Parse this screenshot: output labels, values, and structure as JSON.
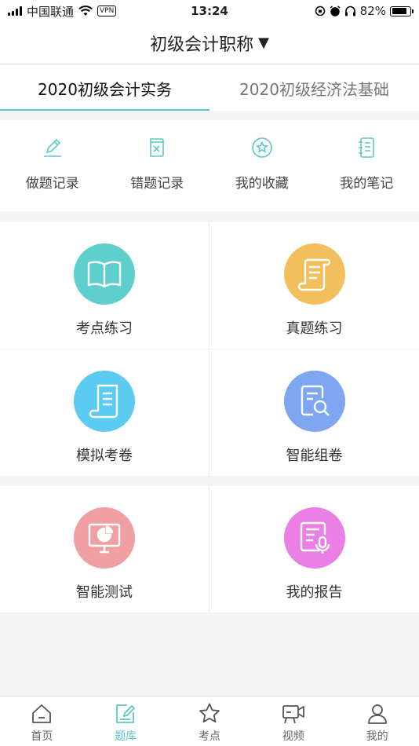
{
  "status_bar": {
    "carrier": "中国联通",
    "vpn": "VPN",
    "time": "13:24",
    "battery_percent": "82%",
    "battery_level": 0.82
  },
  "nav": {
    "title": "初级会计职称",
    "caret": "▼"
  },
  "tabs": [
    {
      "label": "2020初级会计实务",
      "active": true
    },
    {
      "label": "2020初级经济法基础",
      "active": false
    }
  ],
  "quick_actions": [
    {
      "label": "做题记录",
      "icon": "pencil-icon"
    },
    {
      "label": "错题记录",
      "icon": "error-book-icon"
    },
    {
      "label": "我的收藏",
      "icon": "star-circle-icon"
    },
    {
      "label": "我的笔记",
      "icon": "notebook-icon"
    }
  ],
  "features": [
    {
      "label": "考点练习",
      "icon": "open-book-icon",
      "color": "#5ecfcc"
    },
    {
      "label": "真题练习",
      "icon": "scroll-icon",
      "color": "#f2bf5e"
    },
    {
      "label": "模拟考卷",
      "icon": "exam-paper-icon",
      "color": "#5ccbf2"
    },
    {
      "label": "智能组卷",
      "icon": "document-search-icon",
      "color": "#7fa6f0"
    },
    {
      "label": "智能测试",
      "icon": "monitor-chart-icon",
      "color": "#f0a0a2"
    },
    {
      "label": "我的报告",
      "icon": "report-mic-icon",
      "color": "#ea7fe6"
    }
  ],
  "tab_bar": [
    {
      "label": "首页",
      "icon": "home-icon",
      "active": false
    },
    {
      "label": "题库",
      "icon": "question-bank-icon",
      "active": true
    },
    {
      "label": "考点",
      "icon": "star-icon",
      "active": false
    },
    {
      "label": "视频",
      "icon": "video-camera-icon",
      "active": false
    },
    {
      "label": "我的",
      "icon": "user-icon",
      "active": false
    }
  ],
  "colors": {
    "accent": "#5cc8c6",
    "inactive": "#666666"
  }
}
